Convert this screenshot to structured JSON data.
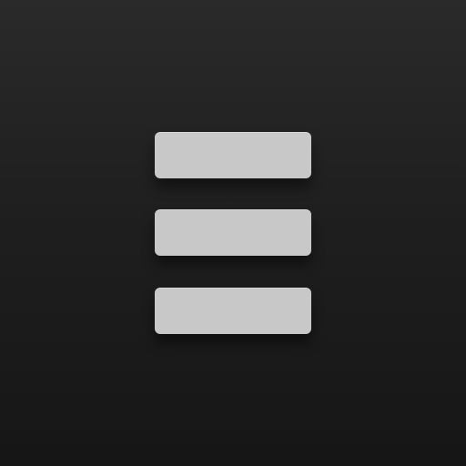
{
  "menu_button": {
    "icon": "hamburger-menu-icon",
    "bars": 3
  },
  "colors": {
    "background_top": "#2a2a2a",
    "background_bottom": "#161616",
    "bar": "#c8c8c8"
  }
}
